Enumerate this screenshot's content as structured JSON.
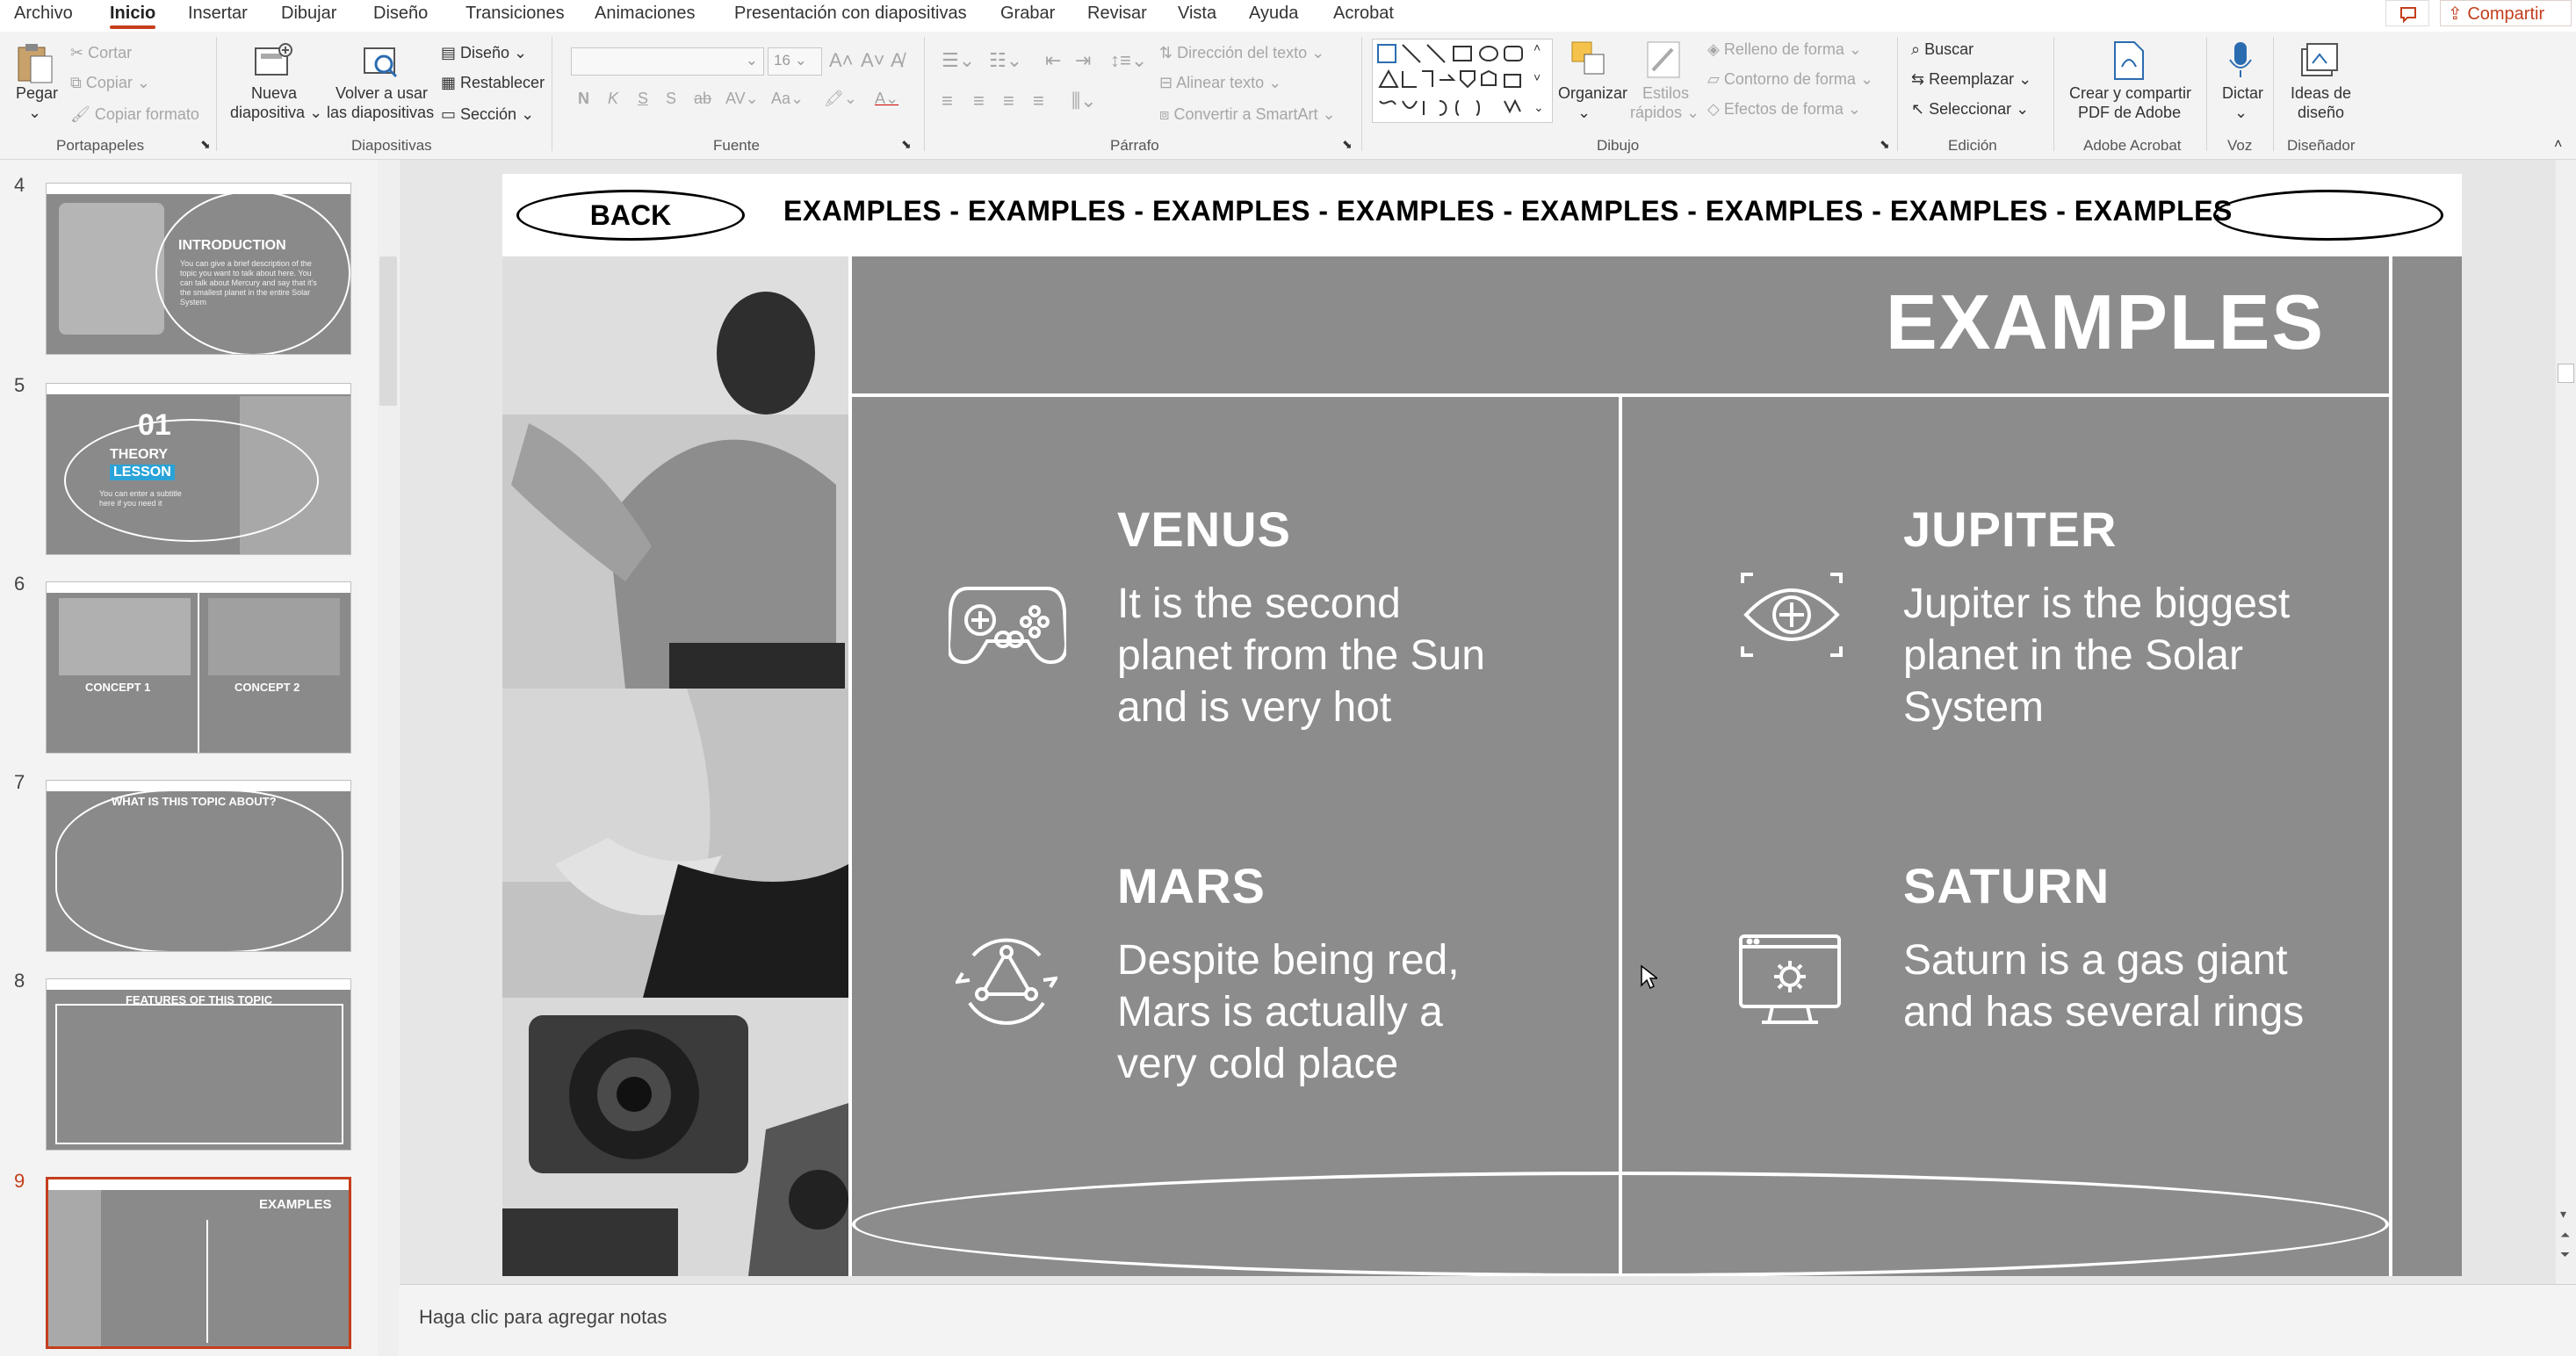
{
  "menu": {
    "tabs": [
      "Archivo",
      "Inicio",
      "Insertar",
      "Dibujar",
      "Diseño",
      "Transiciones",
      "Animaciones",
      "Presentación con diapositivas",
      "Grabar",
      "Revisar",
      "Vista",
      "Ayuda",
      "Acrobat"
    ],
    "share": "Compartir"
  },
  "ribbon": {
    "portapapeles": {
      "paste": "Pegar",
      "cut": "Cortar",
      "copy": "Copiar",
      "format": "Copiar formato",
      "label": "Portapapeles"
    },
    "diapositivas": {
      "new_line1": "Nueva",
      "new_line2": "diapositiva",
      "reuse_line1": "Volver a usar",
      "reuse_line2": "las diapositivas",
      "layout": "Diseño",
      "reset": "Restablecer",
      "section": "Sección",
      "label": "Diapositivas"
    },
    "fuente": {
      "size": "16",
      "label": "Fuente"
    },
    "parrafo": {
      "direction": "Dirección del texto",
      "align": "Alinear texto",
      "smartart": "Convertir a SmartArt",
      "label": "Párrafo"
    },
    "dibujo": {
      "arrange": "Organizar",
      "styles_line1": "Estilos",
      "styles_line2": "rápidos",
      "fill": "Relleno de forma",
      "outline": "Contorno de forma",
      "effects": "Efectos de forma",
      "label": "Dibujo"
    },
    "edicion": {
      "find": "Buscar",
      "replace": "Reemplazar",
      "select": "Seleccionar",
      "label": "Edición"
    },
    "acrobat": {
      "line1": "Crear y compartir",
      "line2": "PDF de Adobe",
      "label": "Adobe Acrobat"
    },
    "voz": {
      "dictate": "Dictar",
      "label": "Voz"
    },
    "disenador": {
      "line1": "Ideas de",
      "line2": "diseño",
      "label": "Diseñador"
    }
  },
  "thumbnails": [
    {
      "num": "4",
      "title": "INTRODUCTION",
      "text": "You can give a brief description of the topic you want to talk about here. You can talk about Mercury and say that it's the smallest planet in the entire Solar System"
    },
    {
      "num": "5",
      "title": "01",
      "title2": "THEORY",
      "title3": "LESSON",
      "text": "You can enter a subtitle here if you need it"
    },
    {
      "num": "6",
      "c1": "CONCEPT 1",
      "c2": "CONCEPT 2"
    },
    {
      "num": "7",
      "title": "WHAT IS THIS TOPIC ABOUT?"
    },
    {
      "num": "8",
      "title": "FEATURES OF THIS TOPIC"
    },
    {
      "num": "9",
      "title": "EXAMPLES"
    }
  ],
  "slide": {
    "back": "BACK",
    "marquee": "EXAMPLES - EXAMPLES - EXAMPLES - EXAMPLES - EXAMPLES - EXAMPLES - EXAMPLES - EXAMPLES",
    "title": "EXAMPLES",
    "items": [
      {
        "heading": "VENUS",
        "body": "It is the second planet from the Sun and is very hot",
        "icon": "gamepad-icon"
      },
      {
        "heading": "JUPITER",
        "body": "Jupiter is the biggest planet in the Solar System",
        "icon": "eye-target-icon"
      },
      {
        "heading": "MARS",
        "body": "Despite being red, Mars is actually a very cold place",
        "icon": "triangle-cycle-icon"
      },
      {
        "heading": "SATURN",
        "body": "Saturn is a gas giant and has several rings",
        "icon": "monitor-gear-icon"
      }
    ]
  },
  "notes": {
    "placeholder": "Haga clic para agregar notas"
  }
}
